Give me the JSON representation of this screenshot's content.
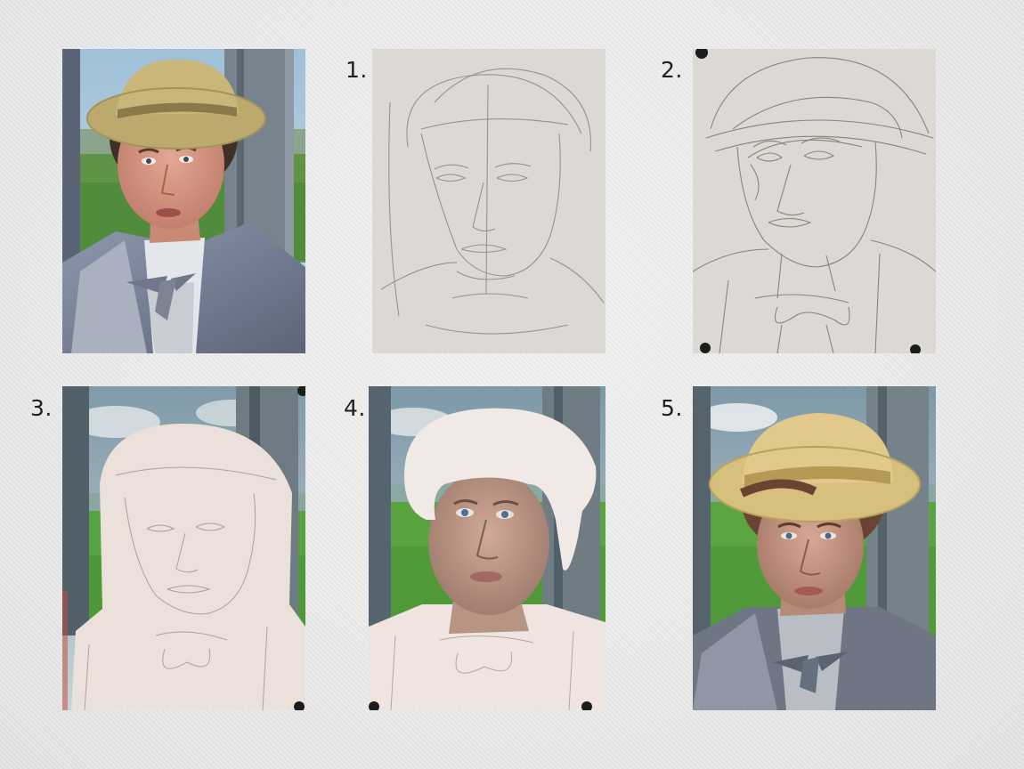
{
  "steps": [
    {
      "label": "1."
    },
    {
      "label": "2."
    },
    {
      "label": "3."
    },
    {
      "label": "4."
    },
    {
      "label": "5."
    }
  ]
}
